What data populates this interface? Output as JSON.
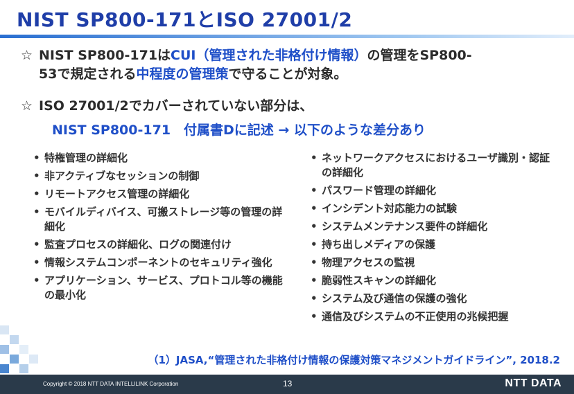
{
  "title": "NIST SP800-171とISO 27001/2",
  "points": [
    {
      "star": "☆",
      "line1_a": "NIST SP800-171は",
      "line1_b": "CUI（管理された非格付け情報）",
      "line1_c": "の管理をSP800-",
      "line2_a": "53で規定される",
      "line2_b": "中程度の管理策",
      "line2_c": "で守ることが対象。"
    },
    {
      "star": "☆",
      "line1": "ISO 27001/2でカバーされていない部分は、"
    }
  ],
  "subline": "NIST SP800-171　付属書Dに記述 → 以下のような差分あり",
  "left_items": [
    "特権管理の詳細化",
    "非アクティブなセッションの制御",
    "リモートアクセス管理の詳細化",
    "モバイルディバイス、可搬ストレージ等の管理の詳細化",
    "監査プロセスの詳細化、ログの関連付け",
    "情報システムコンポーネントのセキュリティ強化",
    "アプリケーション、サービス、プロトコル等の機能の最小化"
  ],
  "right_items": [
    "ネットワークアクセスにおけるユーザ識別・認証の詳細化",
    "パスワード管理の詳細化",
    "インシデント対応能力の試験",
    "システムメンテナンス要件の詳細化",
    "持ち出しメディアの保護",
    "物理アクセスの監視",
    "脆弱性スキャンの詳細化",
    "システム及び通信の保護の強化",
    "通信及びシステムの不正使用の兆候把握"
  ],
  "source": "（1）JASA,“管理された非格付け情報の保護対策マネジメントガイドライン”, 2018.2",
  "footer": {
    "copyright": "Copyright © 2018  NTT DATA INTELLILINK Corporation",
    "page": "13",
    "logo": "NTT DATA"
  },
  "colors": {
    "accent_blue": "#1f4fc8",
    "title_blue": "#1f3ea8",
    "footer_bg": "#2a3a4a"
  }
}
